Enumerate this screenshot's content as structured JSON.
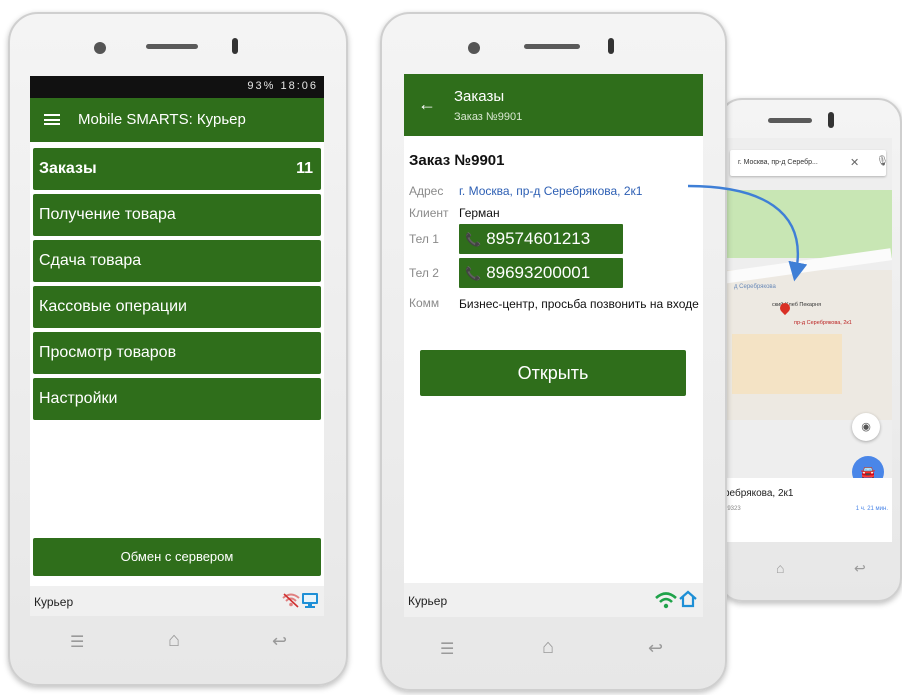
{
  "phone1": {
    "status": {
      "right": "93% 18:06"
    },
    "app_title": "Mobile SMARTS: Курьер",
    "menu": [
      {
        "label": "Заказы",
        "badge": "11"
      },
      {
        "label": "Получение товара"
      },
      {
        "label": "Сдача товара"
      },
      {
        "label": "Кассовые операции"
      },
      {
        "label": "Просмотр товаров"
      },
      {
        "label": "Настройки"
      }
    ],
    "exchange_label": "Обмен с сервером",
    "bottom_label": "Курьер"
  },
  "phone2": {
    "title": "Заказы",
    "subtitle": "Заказ №9901",
    "order_title": "Заказ №9901",
    "address_label": "Адрес",
    "address_value": "г. Москва, пр-д Серебрякова, 2к1",
    "client_label": "Клиент",
    "client_value": "Герман",
    "tel1_label": "Тел 1",
    "tel1_value": "89574601213",
    "tel2_label": "Тел 2",
    "tel2_value": "89693200001",
    "comment_label": "Комм",
    "comment_value": "Бизнес-центр, просьба позвонить на входе",
    "open_label": "Открыть",
    "bottom_label": "Курьер"
  },
  "phone3": {
    "search_query": "г. Москва, пр-д Серебр...",
    "street_label": "д Серебрякова",
    "poi_label": "ский Хлеб Пекарня",
    "poi_marker": "пр-д Серебрякова, 2к1",
    "card_address": "ребрякова, 2к1",
    "card_code": "29323",
    "card_eta": "1 ч. 21 мин."
  },
  "colors": {
    "app_green": "#2f6e1b",
    "link_blue": "#2d5fb4",
    "arrow_blue": "#3f7fd6"
  }
}
